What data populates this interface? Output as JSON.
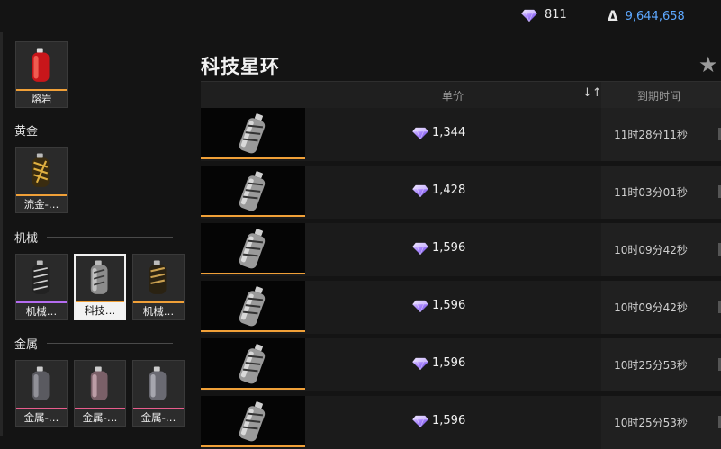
{
  "currency": {
    "gems_icon": "diamond-icon",
    "gems": "811",
    "coins_icon": "coin-icon",
    "coins": "9,644,658"
  },
  "sidebar": {
    "top_item": {
      "name": "熔岩",
      "bar_color": "#f0a038"
    },
    "categories": [
      {
        "label": "黄金",
        "items": [
          {
            "name": "流金-…",
            "bar_color": "#f0a038"
          }
        ]
      },
      {
        "label": "机械",
        "items": [
          {
            "name": "机械…",
            "bar_color": "#b46cf0"
          },
          {
            "name": "科技…",
            "bar_color": "#f0a038",
            "selected": true
          },
          {
            "name": "机械…",
            "bar_color": "#f0a038"
          }
        ]
      },
      {
        "label": "金属",
        "items": [
          {
            "name": "金属-…",
            "bar_color": "#e85c8c"
          },
          {
            "name": "金属-…",
            "bar_color": "#e85c8c"
          },
          {
            "name": "金属-…",
            "bar_color": "#e85c8c"
          }
        ]
      }
    ]
  },
  "main": {
    "title": "科技星环",
    "favorite_icon": "star-icon",
    "columns": {
      "price": "单价",
      "expire": "到期时间",
      "sort_icon": "sort-icon"
    },
    "listings": [
      {
        "price": "1,344",
        "expire": "11时28分11秒"
      },
      {
        "price": "1,428",
        "expire": "11时03分01秒"
      },
      {
        "price": "1,596",
        "expire": "10时09分42秒"
      },
      {
        "price": "1,596",
        "expire": "10时09分42秒"
      },
      {
        "price": "1,596",
        "expire": "10时25分53秒"
      },
      {
        "price": "1,596",
        "expire": "10时25分53秒"
      }
    ]
  }
}
